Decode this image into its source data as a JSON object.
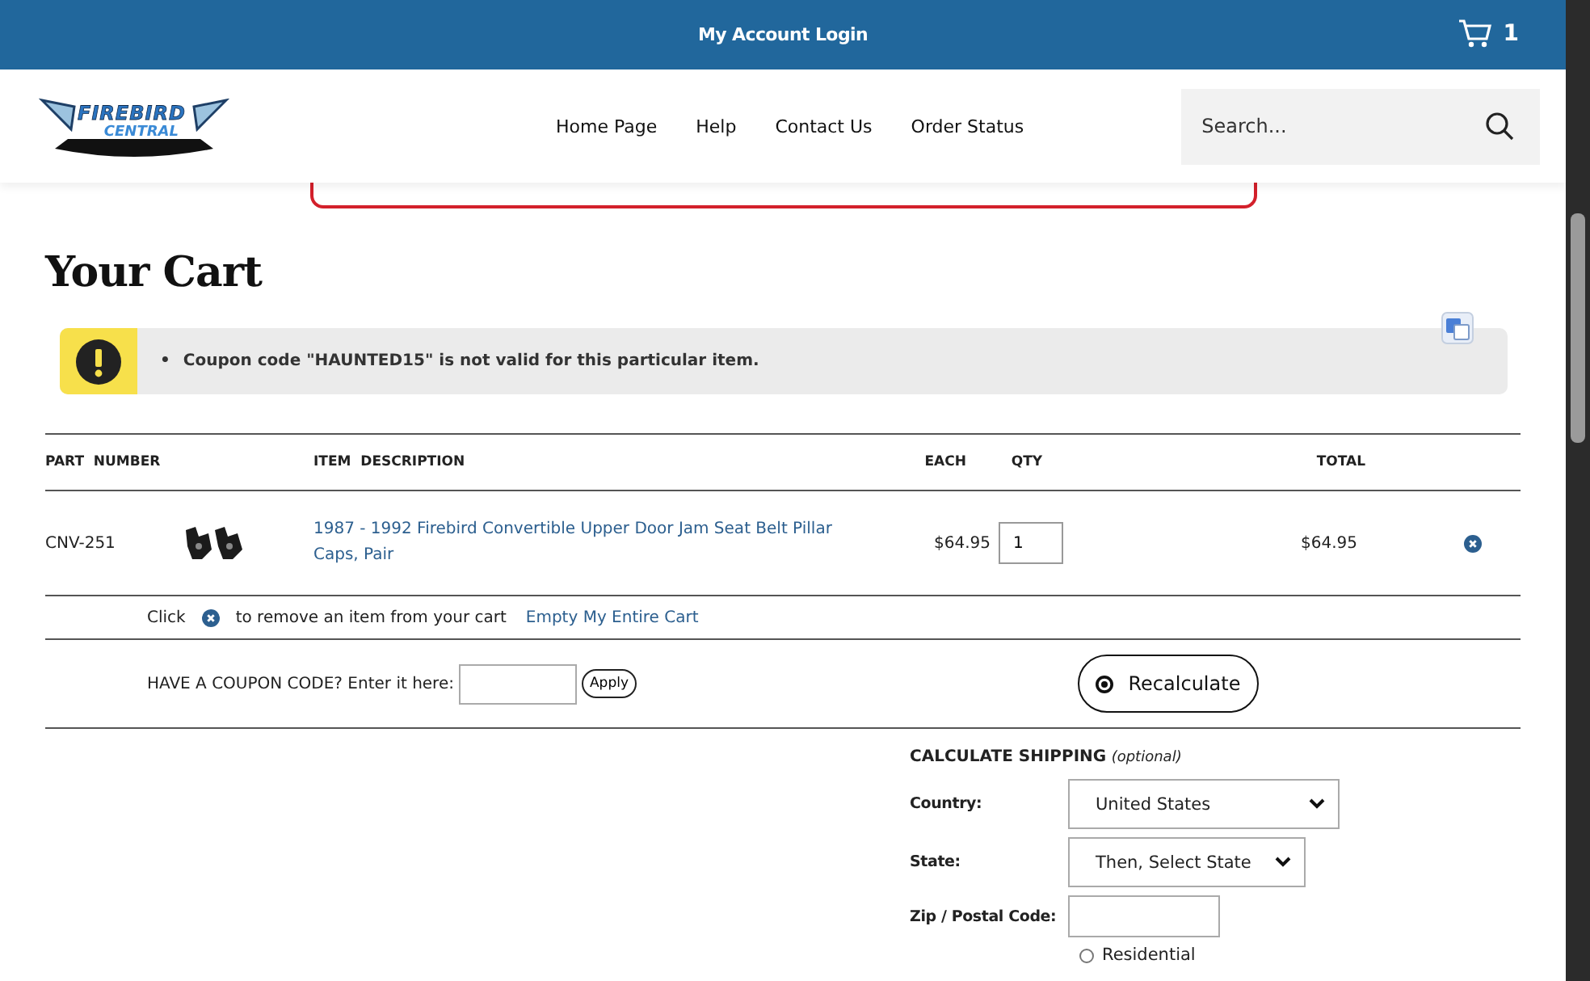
{
  "top_bar": {
    "title": "My Account Login",
    "cart_count": "1"
  },
  "logo": {
    "line1": "FIREBIRD",
    "line2": "CENTRAL"
  },
  "nav": [
    "Home Page",
    "Help",
    "Contact Us",
    "Order Status"
  ],
  "search": {
    "placeholder": "Search..."
  },
  "page_title": "Your Cart",
  "alert": {
    "bullet": "•",
    "messages": [
      "Coupon code \"HAUNTED15\" is not valid for this particular item."
    ]
  },
  "cart": {
    "columns": [
      "PART  NUMBER",
      "ITEM  DESCRIPTION",
      "EACH",
      "QTY",
      "TOTAL"
    ],
    "rows": [
      {
        "part_number": "CNV-251",
        "description": "1987 - 1992 Firebird Convertible Upper Door Jam Seat Belt Pillar Caps, Pair",
        "each": "$64.95",
        "qty": "1",
        "total": "$64.95"
      }
    ]
  },
  "remove_hint": {
    "before": "Click",
    "after": "to remove an item from your cart",
    "link": "Empty My Entire Cart"
  },
  "coupon": {
    "label": "HAVE A COUPON CODE? Enter it here:",
    "button": "Apply"
  },
  "recalculate": "Recalculate",
  "shipping": {
    "title": "CALCULATE SHIPPING",
    "note": "(optional)",
    "fields": [
      {
        "kind": "select",
        "label": "Country:",
        "value": "United States"
      },
      {
        "kind": "select",
        "label": "State:",
        "value": "Then, Select State"
      },
      {
        "kind": "text",
        "label": "Zip / Postal Code:"
      }
    ],
    "address_types": [
      {
        "label": "Residential",
        "selected": false
      }
    ]
  }
}
